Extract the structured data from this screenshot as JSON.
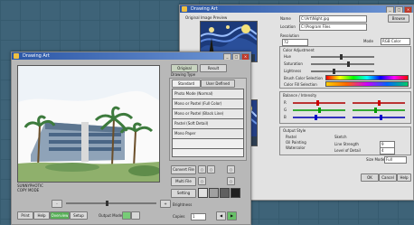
{
  "desktop": {
    "labels": [
      "Cx",
      "x"
    ]
  },
  "win2": {
    "title": "Drawing Art",
    "preview_label": "Original Image Preview",
    "fields": {
      "name_label": "Name",
      "name_value": "C:\\Art\\Night.jpg",
      "location_label": "Location",
      "location_value": "C:\\Program Files",
      "browse": "Browse",
      "resolution_label": "Resolution",
      "resolution_value": "72",
      "mode_label": "Mode",
      "mode_value": "RGB Color"
    },
    "color_adjust": {
      "title": "Color Adjustment",
      "rows": [
        "Hue",
        "Saturation",
        "Lightness",
        "Brush Color Selection",
        "Color Fill Selection"
      ]
    },
    "balance": {
      "title": "Balance / Intensity",
      "channels": [
        "R",
        "G",
        "B"
      ]
    },
    "output": {
      "title": "Output Style",
      "options": [
        "Pastel",
        "Oil Painting",
        "Watercolor",
        "Sketch"
      ],
      "line_strength_label": "Line Strength",
      "line_strength_value": "9",
      "level_label": "Level of Detail",
      "level_value": "4",
      "size_label": "Size Mode",
      "size_value": "Full"
    },
    "buttons": {
      "ok": "OK",
      "cancel": "Cancel",
      "help": "Help"
    }
  },
  "win3": {
    "title": "Drawing Art",
    "status": [
      "SUNNYPHOTIC",
      "COPY MODE"
    ],
    "tabs": [
      "Standard",
      "User Defined"
    ],
    "section_title": "Drawing Type",
    "top_buttons": [
      "Original",
      "Result"
    ],
    "menu": [
      "Photo Mode (Normal)",
      "Mono or Pastel (Full Color)",
      "Mono or Pastel (Black Line)",
      "Pastel (Soft Detail)",
      "Mono Paper"
    ],
    "actions": [
      "Convert File",
      "Multi File",
      "Setting"
    ],
    "brightness_label": "Brightness",
    "bottom_buttons": [
      "Print",
      "Help",
      "Overview",
      "Setup"
    ],
    "mode_label": "Output Mode",
    "copies_label": "Copies",
    "copies_value": "1",
    "swatches": [
      "#e0e0e0",
      "#a0a0a0",
      "#606060",
      "#202020"
    ]
  },
  "colors": {
    "title_start": "#2c57a6",
    "title_end": "#6f97d6"
  }
}
